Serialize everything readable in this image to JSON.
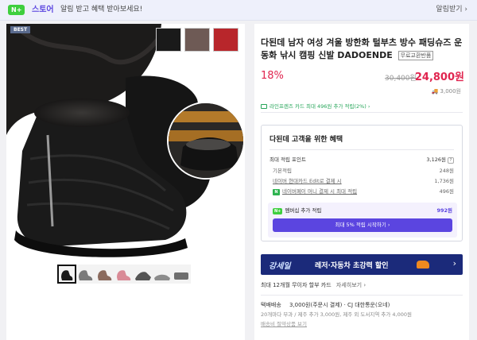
{
  "topbar": {
    "nplus_badge": "N+",
    "store_label": "스토어",
    "message": "알림 받고 혜택 받아보세요!",
    "notify_button": "알림받기 ›"
  },
  "gallery": {
    "best_badge": "BEST",
    "swatch_colors": [
      "#1a1a1a",
      "#6e5a55",
      "#b8262b"
    ],
    "thumbnails": [
      "black-boot",
      "gray-boot",
      "brown-boot",
      "pink-boot",
      "dark-boot",
      "gray-sneaker",
      "gray-slipper"
    ]
  },
  "product": {
    "title": "다된데 남자 여성 겨울 방한화 털부츠 방수 패딩슈즈 운동화 낚시 캠핑 신발 DADOENDE",
    "free_return_badge": "무료교환반품",
    "discount_rate": "18%",
    "original_price": "30,400원",
    "sale_price": "24,800원",
    "shipping_fee": "3,000원",
    "card_benefit": "라인프렌즈 카드 최대 496원 추가 적립(2%) ›"
  },
  "benefits": {
    "title": "다된데 고객을 위한 혜택",
    "max_points_label": "최대 적립 포인트",
    "max_points_value": "3,126원",
    "rows": [
      {
        "label": "기본적립",
        "value": "248원"
      },
      {
        "label": "네이버 현대카드 Edit로 결제 시",
        "value": "1,736원"
      },
      {
        "label": "네이버페이 머니 결제 시 최대 적립",
        "value": "496원"
      }
    ],
    "npay_icon": "N",
    "membership": {
      "badge": "N+",
      "label": "멤버십 추가 적립",
      "value": "992원",
      "button": "최대 5% 적립 시작하기 ›"
    }
  },
  "banner": {
    "logo": "강세일",
    "text": "레저·자동차 초강력 할인",
    "arrow": "›"
  },
  "installment": {
    "text": "최대 12개월 무이자 할부 카드",
    "more_link": "자세히보기 ›"
  },
  "delivery": {
    "label": "택배배송",
    "fee": "3,000원(주문시 결제)",
    "carrier": "· CJ 대한통운(오네)",
    "extra": "20개마다 부과 / 제주 추가 3,000원, 제주 외 도서지역 추가 4,000원",
    "link": "배송비 절약상품 보기"
  }
}
